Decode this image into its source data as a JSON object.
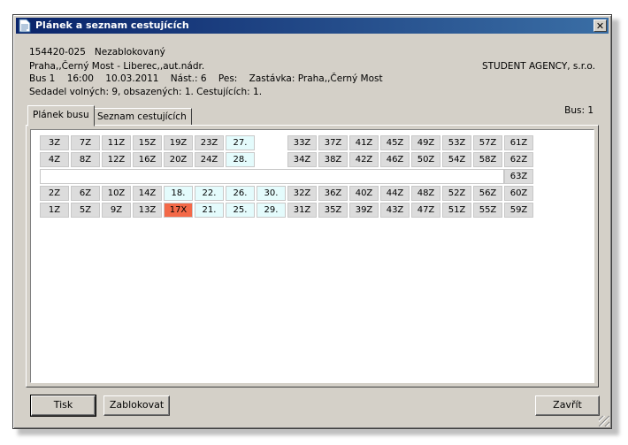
{
  "window": {
    "title": "Plánek a seznam cestujících"
  },
  "info": {
    "line1": "154420-025   Nezablokovaný",
    "line2": "Praha,,Černý Most - Liberec,,aut.nádr.",
    "line3": "Bus 1    16:00    10.03.2011    Nást.: 6    Pes:    Zastávka: Praha,,Černý Most",
    "line4": "Sedadel volných: 9, obsazených: 1. Cestujících: 1.",
    "company": "STUDENT AGENCY, s.r.o.",
    "bus": "Bus: 1"
  },
  "tabs": [
    "Plánek busu",
    "Seznam cestujících"
  ],
  "colors": {
    "blocked": "#dcdcdc",
    "free": "#e4fbfc",
    "taken": "#f36948"
  },
  "seat_rows": [
    [
      "3Z",
      "7Z",
      "11Z",
      "15Z",
      "19Z",
      "23Z",
      "27.",
      "",
      "33Z",
      "37Z",
      "41Z",
      "45Z",
      "49Z",
      "53Z",
      "57Z",
      "61Z"
    ],
    [
      "4Z",
      "8Z",
      "12Z",
      "16Z",
      "20Z",
      "24Z",
      "28.",
      "",
      "34Z",
      "38Z",
      "42Z",
      "46Z",
      "50Z",
      "54Z",
      "58Z",
      "62Z"
    ],
    [
      "",
      "",
      "",
      "",
      "",
      "",
      "",
      "",
      "",
      "",
      "",
      "",
      "",
      "",
      "",
      "63Z"
    ],
    [
      "2Z",
      "6Z",
      "10Z",
      "14Z",
      "18.",
      "22.",
      "26.",
      "30.",
      "32Z",
      "36Z",
      "40Z",
      "44Z",
      "48Z",
      "52Z",
      "56Z",
      "60Z"
    ],
    [
      "1Z",
      "5Z",
      "9Z",
      "13Z",
      "17X",
      "21.",
      "25.",
      "29.",
      "31Z",
      "35Z",
      "39Z",
      "43Z",
      "47Z",
      "51Z",
      "55Z",
      "59Z"
    ]
  ],
  "buttons": {
    "print": "Tisk",
    "block": "Zablokovat",
    "close": "Zavřít"
  }
}
